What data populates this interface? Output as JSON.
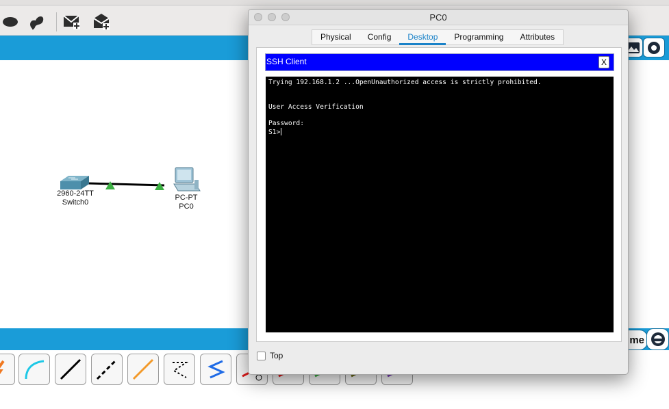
{
  "window": {
    "title": "PC0",
    "tabs": [
      "Physical",
      "Config",
      "Desktop",
      "Programming",
      "Attributes"
    ],
    "active_tab": "Desktop"
  },
  "ssh_client": {
    "title": "SSH Client",
    "close_label": "X",
    "terminal_lines": [
      "Trying 192.168.1.2 ...OpenUnauthorized access is strictly prohibited.",
      "",
      "",
      "User Access Verification",
      "",
      "Password:",
      "S1>"
    ]
  },
  "bottom": {
    "top_checkbox_label": "Top",
    "top_checked": false
  },
  "topology": {
    "switch": {
      "model": "2960-24TT",
      "name": "Switch0"
    },
    "pc": {
      "model": "PC-PT",
      "name": "PC0"
    },
    "link_status_color": "#3cb043"
  },
  "background": {
    "realtime_label_fragment": "me"
  },
  "colors": {
    "accent_blue": "#1a9cd8",
    "ssh_header": "#0000ff",
    "active_tab": "#1a82c8"
  }
}
